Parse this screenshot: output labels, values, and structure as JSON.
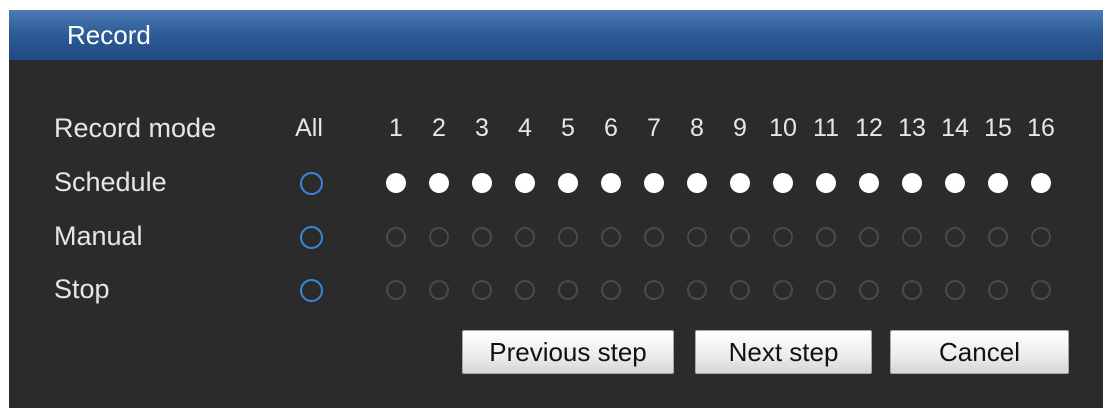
{
  "window": {
    "title": "Record"
  },
  "record_mode": {
    "header_label": "Record mode",
    "all_label": "All",
    "channels": [
      "1",
      "2",
      "3",
      "4",
      "5",
      "6",
      "7",
      "8",
      "9",
      "10",
      "11",
      "12",
      "13",
      "14",
      "15",
      "16"
    ],
    "rows": [
      {
        "label": "Schedule",
        "all_selected": false,
        "selected": [
          true,
          true,
          true,
          true,
          true,
          true,
          true,
          true,
          true,
          true,
          true,
          true,
          true,
          true,
          true,
          true
        ]
      },
      {
        "label": "Manual",
        "all_selected": false,
        "selected": [
          false,
          false,
          false,
          false,
          false,
          false,
          false,
          false,
          false,
          false,
          false,
          false,
          false,
          false,
          false,
          false
        ]
      },
      {
        "label": "Stop",
        "all_selected": false,
        "selected": [
          false,
          false,
          false,
          false,
          false,
          false,
          false,
          false,
          false,
          false,
          false,
          false,
          false,
          false,
          false,
          false
        ]
      }
    ]
  },
  "buttons": {
    "previous_label": "Previous step",
    "next_label": "Next step",
    "cancel_label": "Cancel"
  },
  "colors": {
    "title_bar": "#2f5d98",
    "background": "#2b2b2b",
    "radio_all_border": "#3b86d8",
    "radio_selected": "#ffffff",
    "radio_unselected_border": "#4a4a4a"
  }
}
